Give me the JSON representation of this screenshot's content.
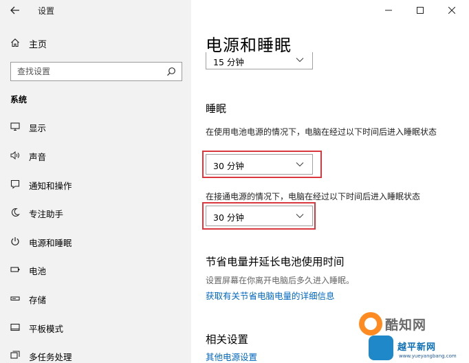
{
  "window": {
    "title": "设置"
  },
  "sidebar": {
    "home_label": "主页",
    "search_placeholder": "查找设置",
    "section_heading": "系统",
    "items": [
      {
        "label": "显示",
        "icon": "monitor-icon"
      },
      {
        "label": "声音",
        "icon": "speaker-icon"
      },
      {
        "label": "通知和操作",
        "icon": "notification-icon"
      },
      {
        "label": "专注助手",
        "icon": "moon-icon"
      },
      {
        "label": "电源和睡眠",
        "icon": "power-icon",
        "active": true
      },
      {
        "label": "电池",
        "icon": "battery-icon"
      },
      {
        "label": "存储",
        "icon": "storage-icon"
      },
      {
        "label": "平板模式",
        "icon": "tablet-icon"
      },
      {
        "label": "多任务处理",
        "icon": "multitask-icon"
      }
    ]
  },
  "main": {
    "page_title": "电源和睡眠",
    "screen_timeout_value": "15 分钟",
    "sleep_heading": "睡眠",
    "sleep_battery_desc": "在使用电池电源的情况下，电脑在经过以下时间后进入睡眠状态",
    "sleep_battery_value": "30 分钟",
    "sleep_plugged_desc": "在接通电源的情况下，电脑在经过以下时间后进入睡眠状态",
    "sleep_plugged_value": "30 分钟",
    "save_power_heading": "节省电量并延长电池使用时间",
    "save_power_desc": "设置屏幕在你离开电脑后多久进入睡眠。",
    "save_power_link": "获取有关节省电脑电量的详细信息",
    "related_heading": "相关设置",
    "related_link": "其他电源设置"
  },
  "watermark": {
    "text1": "酷知网",
    "text2": "越平新网",
    "url": "www.yueyangbang.com"
  },
  "colors": {
    "sidebar_bg": "#f2f2f2",
    "link": "#0067c0",
    "highlight": "#d9363e"
  }
}
